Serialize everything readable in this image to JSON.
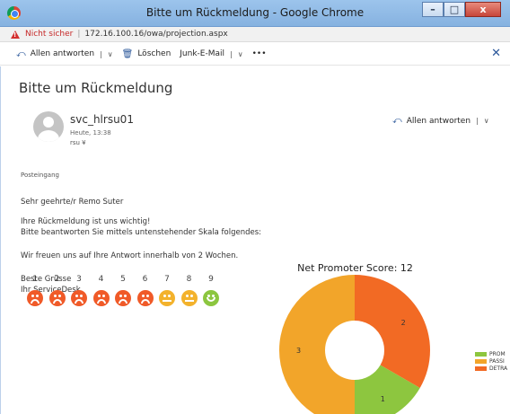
{
  "window": {
    "title": "Bitte um Rückmeldung - Google Chrome",
    "min": "–",
    "max": "□",
    "close": "x"
  },
  "addressbar": {
    "warning": "Nicht sicher",
    "separator": "|",
    "url": "172.16.100.16/owa/projection.aspx"
  },
  "toolbar": {
    "reply_all": "Allen antworten",
    "reply_sep": "|",
    "chevron": "∨",
    "delete": "Löschen",
    "junk": "Junk-E-Mail",
    "junk_sep": "|",
    "more": "•••",
    "close": "✕"
  },
  "mail": {
    "subject": "Bitte um Rückmeldung",
    "sender": "svc_hlrsu01",
    "date": "Heute, 13:38",
    "recipient": "rsu ¥",
    "reply_all": "Allen antworten",
    "reply_sep": "|",
    "reply_chevron": "∨",
    "folder": "Posteingang",
    "lines": [
      "Sehr geehrte/r Remo Suter",
      "Ihre Rückmeldung ist uns wichtig!",
      "Bitte beantworten Sie mittels untenstehender Skala folgendes:",
      "Wir freuen uns auf Ihre Antwort innerhalb von 2 Wochen.",
      "Beste Grüsse",
      "Ihr ServiceDesk"
    ],
    "scale": {
      "numbers": [
        "1",
        "2",
        "3",
        "4",
        "5",
        "6",
        "7",
        "8",
        "9"
      ],
      "faces": [
        "sad",
        "sad",
        "sad",
        "sad",
        "sad",
        "sad",
        "neutral",
        "neutral",
        "happy"
      ],
      "colors": {
        "sad": "#f05a28",
        "neutral": "#f3b22c",
        "happy": "#8cc63f"
      }
    }
  },
  "chart_data": {
    "type": "pie",
    "title": "Net Promoter Score: 12",
    "slices": [
      {
        "name": "PROMOTERS",
        "value": 1,
        "color": "#8dc63f"
      },
      {
        "name": "PASSIVES",
        "value": 3,
        "color": "#f2a52a"
      },
      {
        "name": "DETRACTORS",
        "value": 2,
        "color": "#f26a24"
      }
    ],
    "legend_labels": [
      "PROM",
      "PASSI",
      "DETRA"
    ],
    "donut": true,
    "legend_position": "right"
  }
}
